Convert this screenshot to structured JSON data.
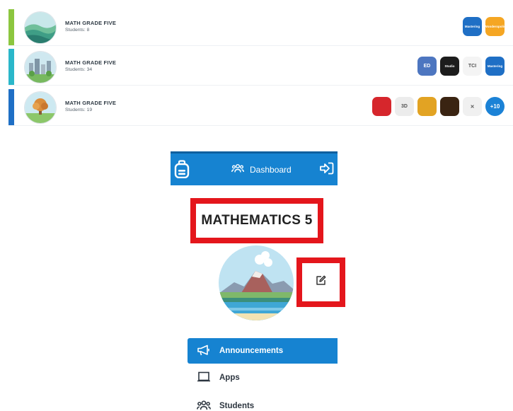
{
  "classes": [
    {
      "name": "MATH GRADE FIVE",
      "students": "Students: 8",
      "bar_color": "#8cc63f",
      "apps": [
        {
          "icon": "mastering-ap-physics-app-icon",
          "label": "Mastering",
          "bg": "#1f6fc5"
        },
        {
          "icon": "smarthistory-app-icon",
          "label": "Wonderopolis",
          "bg": "#f5a623"
        }
      ]
    },
    {
      "name": "MATH GRADE FIVE",
      "students": "Students: 34",
      "bar_color": "#2ab7ca",
      "apps": [
        {
          "icon": "ed-week-app-icon",
          "label": "ED",
          "bg": "#4d76c0"
        },
        {
          "icon": "studio-app-icon",
          "label": "Studio",
          "bg": "#1c1c1c"
        },
        {
          "icon": "tci-app-icon",
          "label": "TCI",
          "bg": "#f4f4f4"
        },
        {
          "icon": "mastering-app-icon",
          "label": "Mastering",
          "bg": "#1f6fc5"
        }
      ]
    },
    {
      "name": "MATH GRADE FIVE",
      "students": "Students: 19",
      "bar_color": "#1f6fc5",
      "apps": [
        {
          "icon": "cube-app-icon",
          "label": "",
          "bg": "#d6262c"
        },
        {
          "icon": "3d-app-icon",
          "label": "3D",
          "bg": "#ececec"
        },
        {
          "icon": "mask-app-icon",
          "label": "",
          "bg": "#e2a323"
        },
        {
          "icon": "lantern-app-icon",
          "label": "",
          "bg": "#3a2412"
        },
        {
          "icon": "x-app-icon",
          "label": "✕",
          "bg": "#f0f0f0"
        },
        {
          "icon": "more-apps-badge",
          "label": "+10",
          "bg": "#1b82d6"
        }
      ]
    }
  ],
  "topbar": {
    "dashboard_label": "Dashboard"
  },
  "course": {
    "title": "MATHEMATICS 5"
  },
  "nav": [
    {
      "label": "Announcements",
      "icon": "megaphone-icon",
      "active": true
    },
    {
      "label": "Apps",
      "icon": "laptop-icon",
      "active": false
    },
    {
      "label": "Students",
      "icon": "people-icon",
      "active": false
    }
  ]
}
